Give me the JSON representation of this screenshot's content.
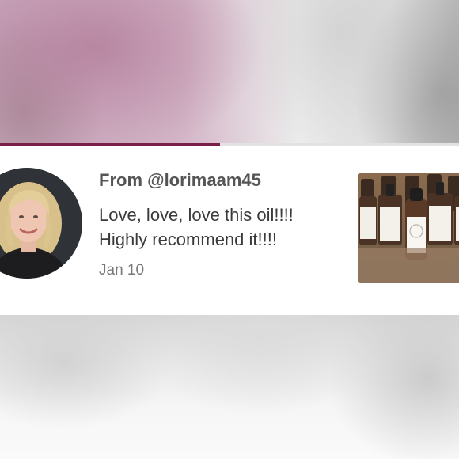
{
  "review": {
    "from_label": "From @lorimaam45",
    "message": "Love, love, love this oil!!!! Highly recommend it!!!!",
    "date": "Jan 10"
  },
  "progress": {
    "fraction": 0.48,
    "color": "#7a1f4a"
  },
  "icons": {
    "avatar": "reviewer-avatar-photo",
    "thumbnail": "product-bottles-photo"
  }
}
